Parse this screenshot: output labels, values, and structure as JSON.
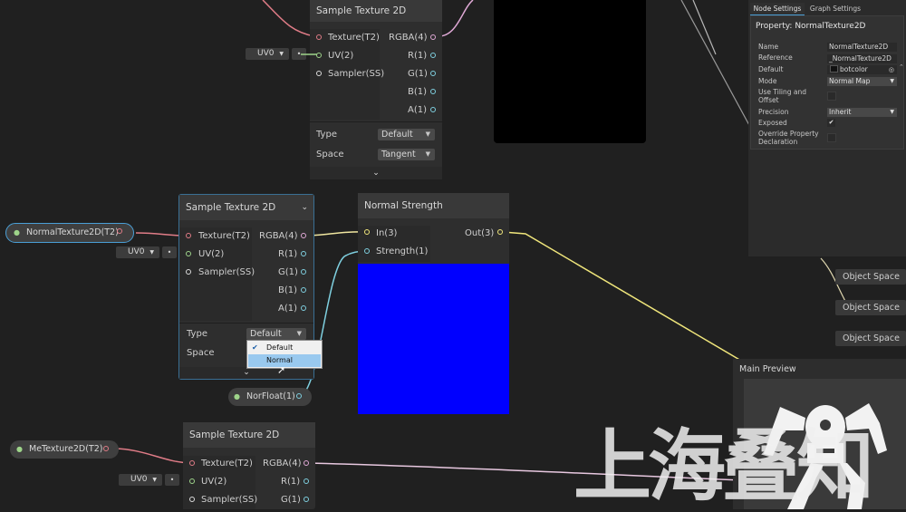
{
  "top_node": {
    "title": "Sample Texture 2D",
    "inputs": [
      "Texture(T2)",
      "UV(2)",
      "Sampler(SS)"
    ],
    "outputs": [
      "RGBA(4)",
      "R(1)",
      "G(1)",
      "B(1)",
      "A(1)"
    ],
    "uv_field": "UV0",
    "type_label": "Type",
    "type_value": "Default",
    "space_label": "Space",
    "space_value": "Tangent"
  },
  "mid_node": {
    "title": "Sample Texture 2D",
    "inputs": [
      "Texture(T2)",
      "UV(2)",
      "Sampler(SS)"
    ],
    "outputs": [
      "RGBA(4)",
      "R(1)",
      "G(1)",
      "B(1)",
      "A(1)"
    ],
    "uv_field": "UV0",
    "type_label": "Type",
    "type_value": "Default",
    "space_label": "Space",
    "dropdown_options": [
      "Default",
      "Normal"
    ]
  },
  "normal_property": {
    "label": "NormalTexture2D(T2)"
  },
  "strength_node": {
    "title": "Normal Strength",
    "inputs": [
      "In(3)",
      "Strength(1)"
    ],
    "output": "Out(3)",
    "preview_color": "#0000ff"
  },
  "nor_float": {
    "label": "NorFloat(1)"
  },
  "bottom_node": {
    "title": "Sample Texture 2D",
    "inputs": [
      "Texture(T2)",
      "UV(2)",
      "Sampler(SS)"
    ],
    "outputs": [
      "RGBA(4)",
      "R(1)",
      "G(1)"
    ],
    "uv_field": "UV0"
  },
  "me_property": {
    "label": "MeTexture2D(T2)"
  },
  "inspector": {
    "tabs": [
      "Node Settings",
      "Graph Settings"
    ],
    "title": "Property: NormalTexture2D",
    "rows": [
      {
        "label": "Name",
        "value": "NormalTexture2D"
      },
      {
        "label": "Reference",
        "value": "_NormalTexture2D"
      },
      {
        "label": "Default",
        "value": "botcolor"
      },
      {
        "label": "Mode",
        "value": "Normal Map"
      },
      {
        "label": "Use Tiling and Offset",
        "value": ""
      },
      {
        "label": "Precision",
        "value": "Inherit"
      },
      {
        "label": "Exposed",
        "value": "✔"
      },
      {
        "label": "Override Property Declaration",
        "value": ""
      }
    ]
  },
  "object_space": [
    "Object Space",
    "Object Space",
    "Object Space"
  ],
  "main_preview": {
    "title": "Main Preview"
  },
  "watermark": "上海叠知",
  "colors": {
    "canvas": "#202020",
    "node": "#2e2e2e",
    "header": "#393939",
    "blue": "#0000ff",
    "selection": "#4a9fd6"
  }
}
